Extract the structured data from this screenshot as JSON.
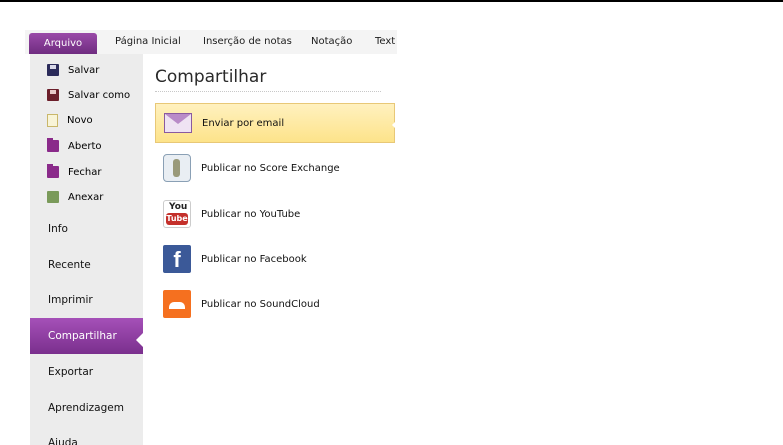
{
  "ribbon": {
    "tabs": [
      {
        "label": "Arquivo"
      },
      {
        "label": "Página Inicial"
      },
      {
        "label": "Inserção de notas"
      },
      {
        "label": "Notação"
      },
      {
        "label": "Text"
      }
    ]
  },
  "sidebar": {
    "commands": [
      {
        "label": "Salvar",
        "icon": "save-icon"
      },
      {
        "label": "Salvar como",
        "icon": "save-as-icon"
      },
      {
        "label": "Novo",
        "icon": "new-document-icon"
      },
      {
        "label": "Aberto",
        "icon": "open-folder-icon"
      },
      {
        "label": "Fechar",
        "icon": "close-folder-icon"
      },
      {
        "label": "Anexar",
        "icon": "attach-icon"
      }
    ],
    "nav": [
      {
        "label": "Info"
      },
      {
        "label": "Recente"
      },
      {
        "label": "Imprimir"
      },
      {
        "label": "Compartilhar",
        "active": true
      },
      {
        "label": "Exportar"
      },
      {
        "label": "Aprendizagem"
      },
      {
        "label": "Ajuda"
      }
    ]
  },
  "main": {
    "title": "Compartilhar",
    "items": [
      {
        "label": "Enviar por email",
        "icon": "email-icon",
        "selected": true
      },
      {
        "label": "Publicar no Score Exchange",
        "icon": "score-exchange-icon"
      },
      {
        "label": "Publicar no YouTube",
        "icon": "youtube-icon"
      },
      {
        "label": "Publicar no Facebook",
        "icon": "facebook-icon"
      },
      {
        "label": "Publicar no SoundCloud",
        "icon": "soundcloud-icon"
      }
    ]
  },
  "colors": {
    "accent": "#7a2f8d",
    "selection": "#fde38a"
  }
}
